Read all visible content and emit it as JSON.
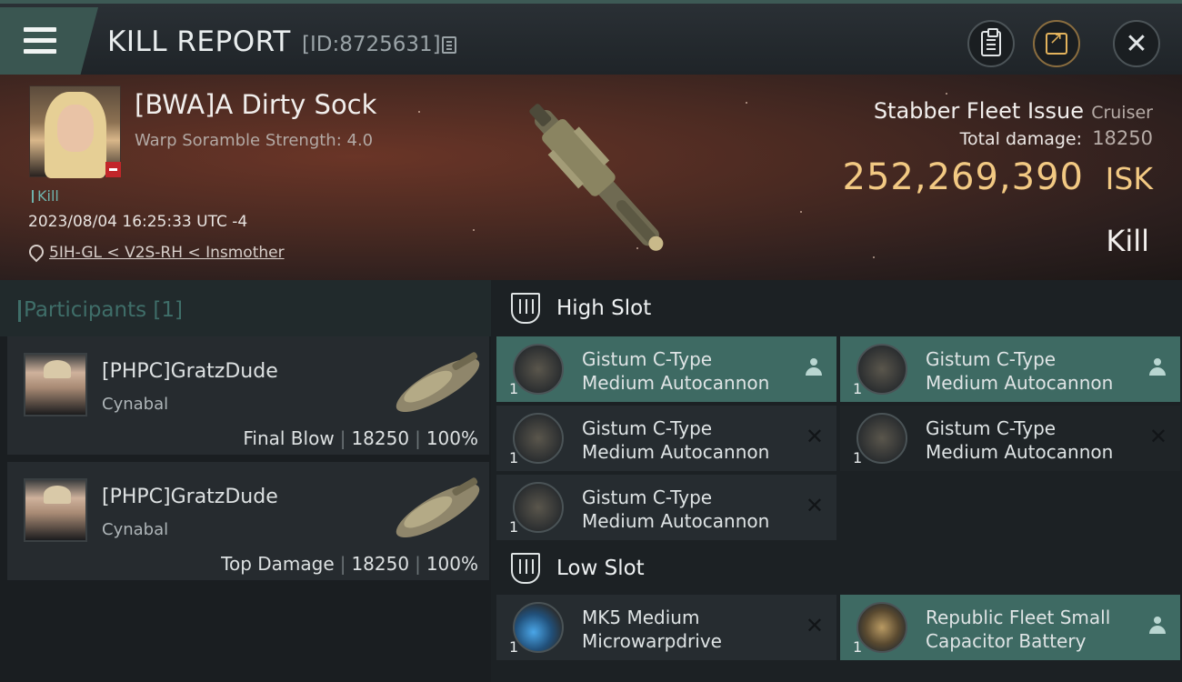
{
  "header": {
    "title": "KILL REPORT",
    "report_id": "[ID:8725631]"
  },
  "victim": {
    "name": "[BWA]A Dirty Sock",
    "scramble": "Warp Soramble Strength: 4.0",
    "tag": "Kill",
    "datetime": "2023/08/04 16:25:33 UTC -4",
    "location": "5IH-GL < V2S-RH < Insmother",
    "ship_name": "Stabber Fleet Issue",
    "ship_class": "Cruiser",
    "total_damage_label": "Total damage:",
    "total_damage": "18250",
    "isk_value": "252,269,390",
    "isk_unit": "ISK",
    "result": "Kill"
  },
  "participants": {
    "title": "Participants [1]",
    "items": [
      {
        "name": "[PHPC]GratzDude",
        "ship": "Cynabal",
        "role": "Final Blow",
        "damage": "18250",
        "percent": "100%"
      },
      {
        "name": "[PHPC]GratzDude",
        "ship": "Cynabal",
        "role": "Top Damage",
        "damage": "18250",
        "percent": "100%"
      }
    ]
  },
  "fitting": {
    "high_slot": {
      "title": "High Slot",
      "modules": [
        {
          "line1": "Gistum C-Type",
          "line2": "Medium Autocannon",
          "qty": "1",
          "state": "dropped"
        },
        {
          "line1": "Gistum C-Type",
          "line2": "Medium Autocannon",
          "qty": "1",
          "state": "dropped"
        },
        {
          "line1": "Gistum C-Type",
          "line2": "Medium Autocannon",
          "qty": "1",
          "state": "destroyed"
        },
        {
          "line1": "Gistum C-Type",
          "line2": "Medium Autocannon",
          "qty": "1",
          "state": "destroyed"
        },
        {
          "line1": "Gistum C-Type",
          "line2": "Medium Autocannon",
          "qty": "1",
          "state": "destroyed"
        }
      ]
    },
    "low_slot": {
      "title": "Low Slot",
      "modules": [
        {
          "line1": "MK5 Medium",
          "line2": "Microwarpdrive",
          "qty": "1",
          "state": "destroyed"
        },
        {
          "line1": "Republic Fleet Small",
          "line2": "Capacitor Battery",
          "qty": "1",
          "state": "dropped"
        }
      ]
    }
  },
  "colors": {
    "accent_teal": "#3e6a63",
    "isk_gold": "#f2c983",
    "danger_red": "#c2262a"
  },
  "icons": [
    "menu-icon",
    "copy-icon",
    "clipboard-icon",
    "share-icon",
    "close-icon",
    "location-pin-icon",
    "slot-icon",
    "person-icon",
    "x-icon"
  ]
}
